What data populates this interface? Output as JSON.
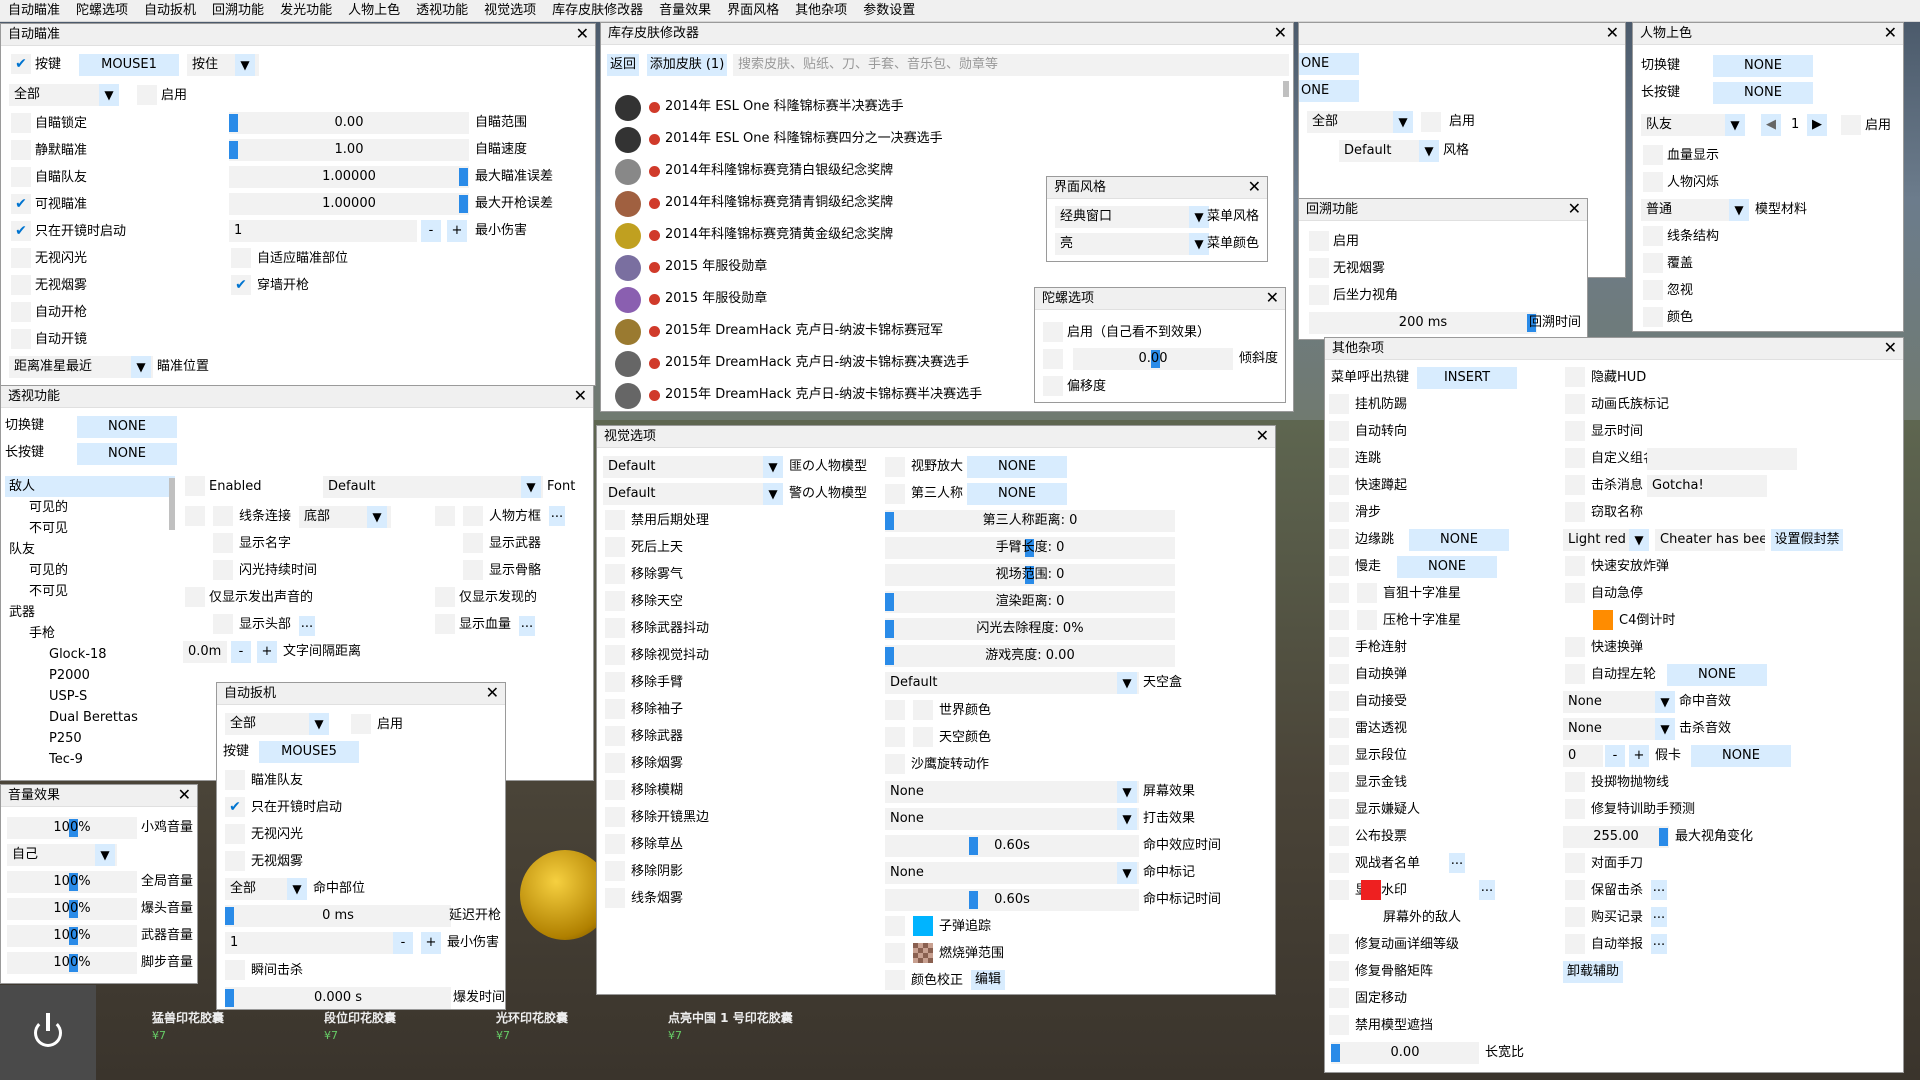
{
  "menu": [
    "自动瞄准",
    "陀螺选项",
    "自动扳机",
    "回溯功能",
    "发光功能",
    "人物上色",
    "透视功能",
    "视觉选项",
    "库存皮肤修改器",
    "音量效果",
    "界面风格",
    "其他杂项",
    "参数设置"
  ],
  "aimbot": {
    "title": "自动瞄准",
    "key_label": "按键",
    "key": "MOUSE1",
    "mode": "按住",
    "group": "全部",
    "enable": "启用",
    "aim_lock": "自瞄锁定",
    "silent": "静默瞄准",
    "team": "自瞄队友",
    "visible_only": "可视瞄准",
    "scope_only": "只在开镜时启动",
    "ignore_flash": "无视闪光",
    "ignore_smoke": "无视烟雾",
    "autoshoot": "自动开枪",
    "autoscope": "自动开镜",
    "fov": "0.00",
    "fov_label": "自瞄范围",
    "smooth": "1.00",
    "smooth_label": "自瞄速度",
    "max_aim_inacc": "1.00000",
    "max_aim_inacc_label": "最大瞄准误差",
    "max_shot_inacc": "1.00000",
    "max_shot_inacc_label": "最大开枪误差",
    "min_damage": "1",
    "min_damage_label": "最小伤害",
    "adaptive": "自适应瞄准部位",
    "wallbang": "穿墙开枪",
    "target": "距离准星最近",
    "target_label": "瞄准位置"
  },
  "antiaim": {
    "title": "陀螺选项",
    "enable": "启用（自己看不到效果）",
    "pitch": "0.00",
    "pitch_label": "倾斜度",
    "yaw": "偏移度"
  },
  "trigger": {
    "title": "自动扳机",
    "group": "全部",
    "enable": "启用",
    "key_label": "按键",
    "key": "MOUSE5",
    "team": "瞄准队友",
    "scope_only": "只在开镜时启动",
    "ignore_flash": "无视闪光",
    "ignore_smoke": "无视烟雾",
    "hitgroup": "全部",
    "hitgroup_label": "命中部位",
    "delay": "0 ms",
    "delay_label": "延迟开枪",
    "min_damage": "1",
    "min_damage_label": "最小伤害",
    "killshot": "瞬间击杀",
    "burst": "0.000 s",
    "burst_label": "爆发时间"
  },
  "backtrack": {
    "title": "回溯功能",
    "enable": "启用",
    "ignore_smoke": "无视烟雾",
    "recoil": "后坐力视角",
    "time": "200 ms",
    "time_label": "回溯时间"
  },
  "glow_partial": {
    "key1": "ONE",
    "key2": "ONE",
    "group": "全部",
    "enable": "启用",
    "style": "Default",
    "style_label": "风格"
  },
  "chams": {
    "title": "人物上色",
    "toggle_label": "切换键",
    "toggle": "NONE",
    "hold_label": "长按键",
    "hold": "NONE",
    "group": "队友",
    "index": "1",
    "enable": "启用",
    "health": "血量显示",
    "blink": "人物闪烁",
    "material": "普通",
    "material_label": "模型材料",
    "wireframe": "线条结构",
    "cover": "覆盖",
    "ignorez": "忽视",
    "color": "颜色"
  },
  "esp": {
    "title": "透视功能",
    "toggle_label": "切换键",
    "toggle": "NONE",
    "hold_label": "长按键",
    "hold": "NONE",
    "tree": [
      "敌人",
      "可见的",
      "不可见",
      "队友",
      "可见的",
      "不可见",
      "武器",
      "手枪",
      "Glock-18",
      "P2000",
      "USP-S",
      "Dual Berettas",
      "P250",
      "Tec-9"
    ],
    "enabled": "Enabled",
    "font": "Default",
    "font_label": "Font",
    "snaplines": "线条连接",
    "snap_pos": "底部",
    "box": "人物方框",
    "name": "显示名字",
    "weapon": "显示武器",
    "flash": "闪光持续时间",
    "skeleton": "显示骨骼",
    "audible": "仅显示发出声音的",
    "spotted": "仅显示发现的",
    "head": "显示头部",
    "health": "显示血量",
    "distance": "0.0m",
    "distance_label": "文字间隔距离"
  },
  "sound": {
    "title": "音量效果",
    "chicken": "100%",
    "chicken_label": "小鸡音量",
    "who": "自己",
    "master": "100%",
    "master_label": "全局音量",
    "headshot": "100%",
    "headshot_label": "爆头音量",
    "weapon": "100%",
    "weapon_label": "武器音量",
    "footstep": "100%",
    "footstep_label": "脚步音量"
  },
  "skins": {
    "title": "库存皮肤修改器",
    "back": "返回",
    "add": "添加皮肤 (1)",
    "search_placeholder": "搜索皮肤、贴纸、刀、手套、音乐包、勋章等",
    "items": [
      "2014年 ESL One 科隆锦标赛半决赛选手",
      "2014年 ESL One 科隆锦标赛四分之一决赛选手",
      "2014年科隆锦标赛竞猜白银级纪念奖牌",
      "2014年科隆锦标赛竞猜青铜级纪念奖牌",
      "2014年科隆锦标赛竞猜黄金级纪念奖牌",
      "2015 年服役勋章",
      "2015 年服役勋章",
      "2015年 DreamHack 克卢日-纳波卡锦标赛冠军",
      "2015年 DreamHack 克卢日-纳波卡锦标赛决赛选手",
      "2015年 DreamHack 克卢日-纳波卡锦标赛半决赛选手"
    ]
  },
  "style": {
    "title": "界面风格",
    "menu_style": "经典窗口",
    "menu_style_label": "菜单风格",
    "menu_color": "亮",
    "menu_color_label": "菜单颜色"
  },
  "visuals": {
    "title": "视觉选项",
    "t_model": "Default",
    "t_model_label": "匪の人物模型",
    "ct_model": "Default",
    "ct_model_label": "警の人物模型",
    "left": [
      "禁用后期处理",
      "死后上天",
      "移除雾气",
      "移除天空",
      "移除武器抖动",
      "移除视觉抖动",
      "移除手臂",
      "移除袖子",
      "移除武器",
      "移除烟雾",
      "移除模糊",
      "移除开镜黑边",
      "移除草丛",
      "移除阴影",
      "线条烟雾"
    ],
    "zoom_label": "视野放大",
    "zoom": "NONE",
    "third_label": "第三人称",
    "third": "NONE",
    "third_dist": "第三人称距离: 0",
    "hand_fov": "手臂长度: 0",
    "view_fov": "视场范围: 0",
    "far_z": "渲染距离: 0",
    "flash_red": "闪光去除程度: 0%",
    "brightness": "游戏亮度: 0.00",
    "skybox": "Default",
    "skybox_label": "天空盒",
    "world_color": "世界颜色",
    "sky_color": "天空颜色",
    "deagle_spin": "沙鹰旋转动作",
    "screen_effect": "None",
    "screen_effect_label": "屏幕效果",
    "hit_effect": "None",
    "hit_effect_label": "打击效果",
    "hit_effect_time": "0.60s",
    "hit_effect_time_label": "命中效应时间",
    "hit_marker": "None",
    "hit_marker_label": "命中标记",
    "hit_marker_time": "0.60s",
    "hit_marker_time_label": "命中标记时间",
    "bullet_tracers": "子弹追踪",
    "molotov": "燃烧弹范围",
    "color_correction": "颜色校正",
    "edit": "编辑"
  },
  "misc": {
    "title": "其他杂项",
    "menu_key_label": "菜单呼出热键",
    "menu_key": "INSERT",
    "anti_afk": "挂机防踢",
    "autostrafe": "自动转向",
    "bhop": "连跳",
    "fastduck": "快速蹲起",
    "moonwalk": "滑步",
    "edgejump": "边缘跳",
    "edgejump_key": "NONE",
    "slowwalk": "慢走",
    "slowwalk_key": "NONE",
    "sniper_cross": "盲狙十字准星",
    "recoil_cross": "压枪十字准星",
    "autopistol": "手枪连射",
    "autoreload": "自动换弹",
    "autoaccept": "自动接受",
    "radar": "雷达透视",
    "ranks": "显示段位",
    "money": "显示金钱",
    "suspect": "显示嫌疑人",
    "vote": "公布投票",
    "spectators": "观战者名单",
    "watermark": "显示水印",
    "offscreen": "屏幕外的敌人",
    "fix_anim": "修复动画详细等级",
    "fix_bone": "修复骨骼矩阵",
    "fix_move": "固定移动",
    "disable_occ": "禁用模型遮挡",
    "aspect": "0.00",
    "aspect_label": "长宽比",
    "hide_hud": "隐藏HUD",
    "clan_tag": "动画氏族标记",
    "show_time": "显示时间",
    "custom_clan": "自定义组名",
    "kill_msg": "击杀消息",
    "kill_msg_text": "Gotcha!",
    "name_steal": "窃取名称",
    "ban_color": "Light red",
    "ban_text": "Cheater has been p",
    "ban_btn": "设置假封禁",
    "fast_plant": "快速安放炸弹",
    "auto_stop": "自动急停",
    "c4_timer": "C4倒计时",
    "quick_switch": "快速换弹",
    "prepare_revolver": "自动捏左轮",
    "revolver_key": "NONE",
    "hit_sound": "None",
    "hit_sound_label": "命中音效",
    "kill_sound": "None",
    "kill_sound_label": "击杀音效",
    "fake_prime": "0",
    "fake_prime_label": "假卡",
    "fake_prime_key": "NONE",
    "grenade_pred": "投掷物抛物线",
    "fix_tablet": "修复特训助手预测",
    "max_angle": "255.00",
    "max_angle_label": "最大视角变化",
    "opponent_hand": "对面手刀",
    "keep_kills": "保留击杀",
    "purchase": "购买记录",
    "auto_report": "自动举报",
    "unload": "卸载辅助",
    "more": "..."
  },
  "store": [
    "猛兽印花胶囊",
    "段位印花胶囊",
    "光环印花胶囊",
    "点亮中国 1 号印花胶囊"
  ],
  "price": "¥7",
  "colors": {
    "accent": "#d8ecfe",
    "check": "#0074d0",
    "slider": "#2a8be8",
    "orange": "#ff8c00",
    "red": "#ee2020",
    "cyan": "#00b4ff"
  }
}
